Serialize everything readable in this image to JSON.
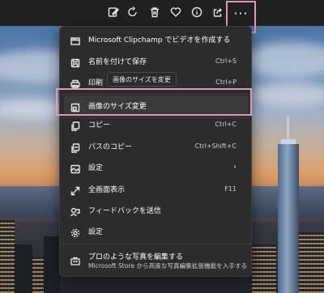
{
  "toolbar": {
    "buttons": [
      {
        "name": "edit-icon"
      },
      {
        "name": "rotate-icon"
      },
      {
        "name": "delete-icon"
      },
      {
        "name": "heart-icon"
      },
      {
        "name": "info-icon"
      },
      {
        "name": "share-icon"
      }
    ],
    "more_label": "···"
  },
  "menu": {
    "items": [
      {
        "label": "Microsoft Clipchamp でビデオを作成する",
        "shortcut": "",
        "icon": "clipchamp-icon"
      },
      {
        "label": "名前を付けて保存",
        "shortcut": "Ctrl+S",
        "icon": "save-icon"
      },
      {
        "label": "印刷",
        "shortcut": "Ctrl+P",
        "icon": "print-icon"
      },
      {
        "label": "画像のサイズ変更",
        "shortcut": "",
        "icon": "resize-icon"
      },
      {
        "label": "コピー",
        "shortcut": "Ctrl+C",
        "icon": "copy-icon"
      },
      {
        "label": "パスのコピー",
        "shortcut": "Ctrl+Shift+C",
        "icon": "copy-path-icon"
      },
      {
        "label": "設定",
        "shortcut": "",
        "icon": "set-as-icon",
        "submenu": "›"
      },
      {
        "label": "全画面表示",
        "shortcut": "F11",
        "icon": "fullscreen-icon"
      },
      {
        "label": "フィードバックを送信",
        "shortcut": "",
        "icon": "feedback-icon"
      },
      {
        "label": "設定",
        "shortcut": "",
        "icon": "gear-icon"
      }
    ],
    "tooltip": "画像のサイズを変更",
    "promo": {
      "title": "プロのような写真を編集する",
      "subtitle": "Microsoft Store から高度な写真編集拡張機能を入手する",
      "icon": "store-icon"
    }
  },
  "colors": {
    "highlight_frame": "#e597b9",
    "menu_bg": "#2c2c2c"
  }
}
